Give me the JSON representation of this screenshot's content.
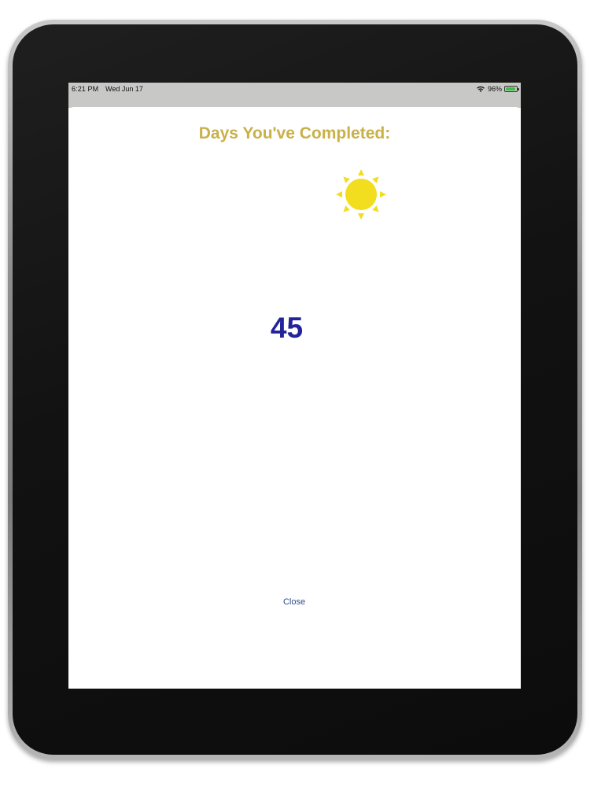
{
  "status_bar": {
    "time": "6:21 PM",
    "date": "Wed Jun 17",
    "battery_percent": "96%",
    "battery_level": 0.96,
    "battery_color": "#3cc043",
    "icons": [
      "wifi-icon",
      "battery-icon"
    ]
  },
  "modal": {
    "title": "Days You've Completed:",
    "title_color": "#c9b048",
    "icon": "sun-icon",
    "sun_color": "#f2de1e",
    "count": "45",
    "count_color": "#23239a",
    "close_label": "Close",
    "close_color": "#2f4a8c"
  }
}
